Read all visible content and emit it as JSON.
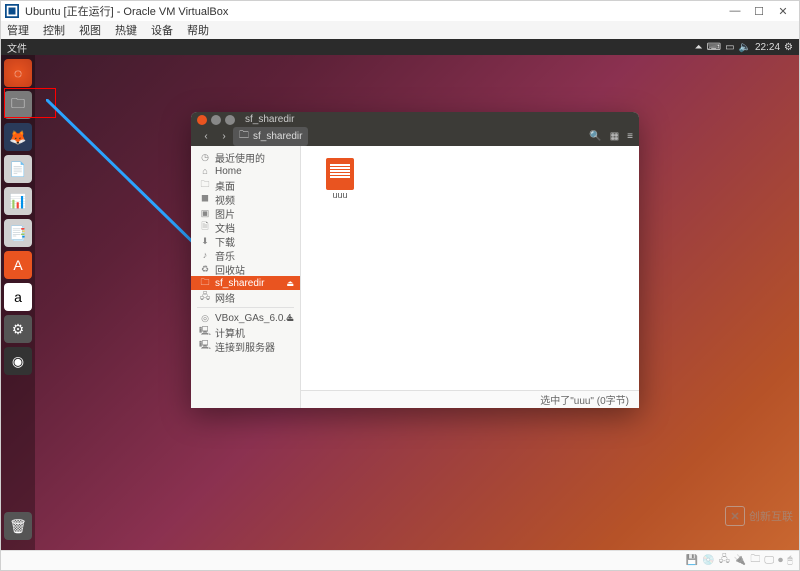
{
  "vbox": {
    "title": "Ubuntu [正在运行] - Oracle VM VirtualBox",
    "menu": [
      "管理",
      "控制",
      "视图",
      "热键",
      "设备",
      "帮助"
    ]
  },
  "ubuntu": {
    "topbar_left": "文件",
    "time": "22:24",
    "launcher": [
      {
        "name": "dash",
        "glyph": "◌"
      },
      {
        "name": "files",
        "glyph": "🗀"
      },
      {
        "name": "firefox",
        "glyph": "🦊"
      },
      {
        "name": "writer",
        "glyph": "📄"
      },
      {
        "name": "calc",
        "glyph": "📊"
      },
      {
        "name": "impress",
        "glyph": "📑"
      },
      {
        "name": "software",
        "glyph": "A"
      },
      {
        "name": "amazon",
        "glyph": "a"
      },
      {
        "name": "settings",
        "glyph": "⚙"
      },
      {
        "name": "help",
        "glyph": "◉"
      }
    ],
    "trash_glyph": "🗑"
  },
  "nautilus": {
    "title": "sf_sharedir",
    "breadcrumb": "sf_sharedir",
    "sidebar": [
      {
        "icon": "◷",
        "label": "最近使用的"
      },
      {
        "icon": "⌂",
        "label": "Home"
      },
      {
        "icon": "🗀",
        "label": "桌面"
      },
      {
        "icon": "⯀",
        "label": "视频"
      },
      {
        "icon": "▣",
        "label": "图片"
      },
      {
        "icon": "🗎",
        "label": "文档"
      },
      {
        "icon": "⬇",
        "label": "下载"
      },
      {
        "icon": "♪",
        "label": "音乐"
      },
      {
        "icon": "♻",
        "label": "回收站"
      },
      {
        "icon": "🗀",
        "label": "sf_sharedir",
        "selected": true,
        "eject": true
      },
      {
        "icon": "🖧",
        "label": "网络"
      },
      {
        "sep": true
      },
      {
        "icon": "◎",
        "label": "VBox_GAs_6.0.4",
        "eject": true
      },
      {
        "icon": "🖳",
        "label": "计算机"
      },
      {
        "icon": "🖳",
        "label": "连接到服务器"
      }
    ],
    "files": [
      {
        "name": "uuu"
      }
    ],
    "status": "选中了\"uuu\" (0字节)"
  },
  "watermark": {
    "symbol": "✕",
    "text": "创新互联"
  }
}
